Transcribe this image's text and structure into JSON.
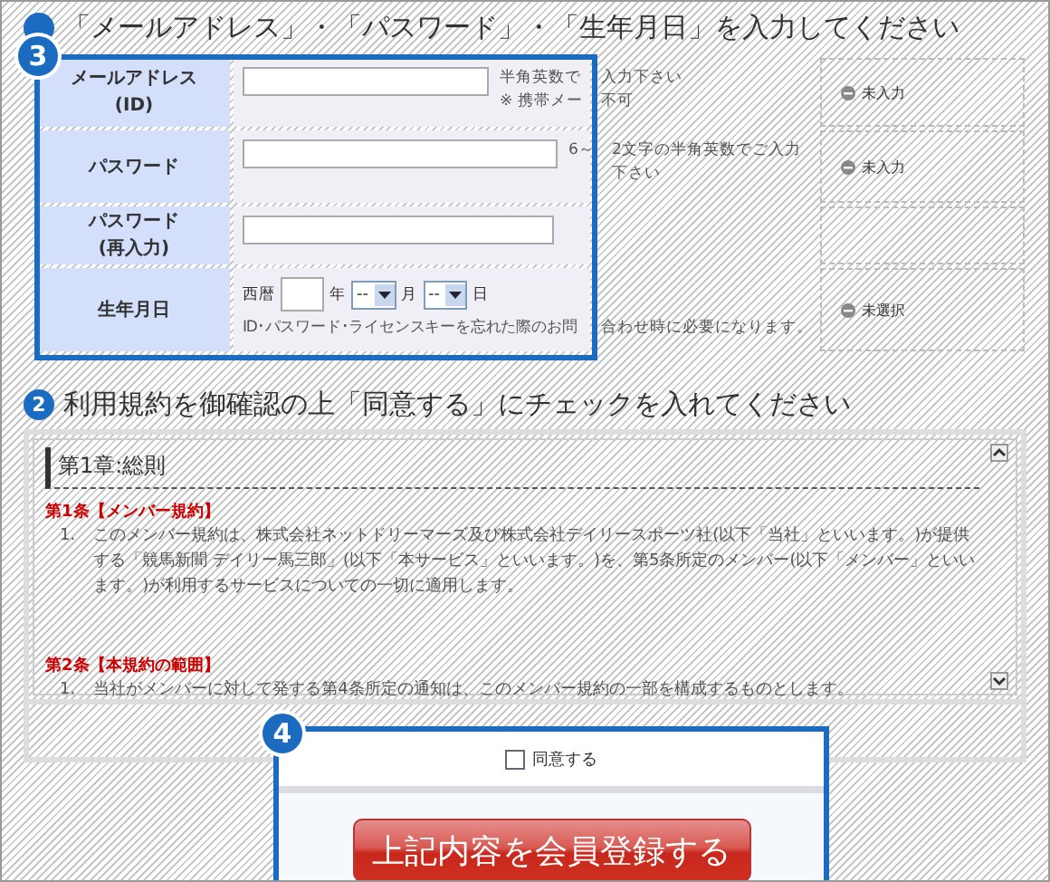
{
  "heading_1": {
    "text": "「メールアドレス」・「パスワード」・「生年月日」を入力してください"
  },
  "form": {
    "rows": [
      {
        "kind": "text",
        "label": [
          "メールアドレス",
          "(ID)"
        ],
        "notes": [
          {
            "left": "半角英数で",
            "right": "入力下さい"
          },
          {
            "left": "※ 携帯メー",
            "right": "不可"
          }
        ],
        "status": "未入力"
      },
      {
        "kind": "password",
        "label": [
          "パスワード"
        ],
        "notes": [
          {
            "left": "6～",
            "right": "2文字の半角英数でご入力下さい"
          }
        ],
        "status": "未入力"
      },
      {
        "kind": "password",
        "label": [
          "パスワード",
          "(再入力)"
        ],
        "notes": []
      },
      {
        "kind": "date",
        "label": [
          "生年月日"
        ],
        "era": "西暦",
        "year_unit": "年",
        "month": "--",
        "month_unit": "月",
        "day": "--",
        "day_unit": "日",
        "notes": [
          {
            "left": "ID･パスワード･ライセンスキーを忘れた際のお問",
            "right": "合わせ時に必要になります。"
          }
        ],
        "status": "未選択"
      }
    ]
  },
  "heading_2": {
    "number": "2",
    "text": "利用規約を御確認の上「同意する」にチェックを入れてください"
  },
  "terms": {
    "chapter": "第1章:総則",
    "articles": [
      {
        "title": "第1条【メンバー規約】",
        "items": [
          {
            "number": "1.",
            "text": "このメンバー規約は、株式会社ネットドリーマーズ及び株式会社デイリースポーツ社(以下「当社」といいます。)が提供する「競馬新聞 デイリー馬三郎」(以下「本サービス」といいます。)を、第5条所定のメンバー(以下「メンバー」といいます。)が利用するサービスについての一切に適用します。"
          }
        ]
      },
      {
        "title": "第2条【本規約の範囲】",
        "items": [
          {
            "number": "1.",
            "text": "当社がメンバーに対して発する第4条所定の通知は、このメンバー規約の一部を構成するものとします。"
          }
        ]
      }
    ]
  },
  "agree": {
    "label": "同意する",
    "checked": false
  },
  "submit_button": "上記内容を会員登録する",
  "callouts": [
    {
      "number": "3"
    },
    {
      "number": "4"
    }
  ]
}
